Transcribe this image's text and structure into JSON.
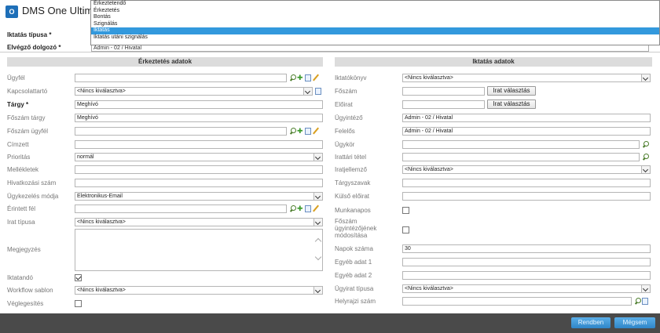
{
  "app": {
    "title": "DMS One Ultimate"
  },
  "dropdown": {
    "options": [
      "Érkeztetendő",
      "Érkeztetés",
      "Bontás",
      "Szignálás",
      "Iktatás",
      "Iktatás utáni szignálás"
    ],
    "selected": "Iktatás"
  },
  "top": {
    "iktatas_tipusa_label": "Iktatás típusa *",
    "elvegzo_label": "Elvégző dolgozó *",
    "elvegzo_value": "Admin - 02 / Hivatal"
  },
  "left": {
    "header": "Érkeztetés adatok",
    "ugyfel_label": "Ügyfél",
    "kapcsolattarto_label": "Kapcsolattartó",
    "kapcsolattarto_value": "<Nincs kiválasztva>",
    "targy_label": "Tárgy *",
    "targy_value": "Meghívó",
    "foszam_targy_label": "Főszám tárgy",
    "foszam_targy_value": "Meghívó",
    "foszam_ugyfel_label": "Főszám ügyfél",
    "cimzett_label": "Címzett",
    "prioritas_label": "Prioritás",
    "prioritas_value": "normál",
    "mellekletek_label": "Mellékletek",
    "hivatkozasi_szam_label": "Hivatkozási szám",
    "ugykezeles_modja_label": "Ügykezelés módja",
    "ugykezeles_modja_value": "Elektronikus-Email",
    "erintett_fel_label": "Érintett fél",
    "irat_tipusa_label": "Irat típusa",
    "irat_tipusa_value": "<Nincs kiválasztva>",
    "megjegyzes_label": "Megjegyzés",
    "iktatando_label": "Iktatandó",
    "iktatando_checked": true,
    "workflow_sablon_label": "Workflow sablon",
    "workflow_sablon_value": "<Nincs kiválasztva>",
    "veglegesites_label": "Véglegesítés",
    "veglegesites_checked": false
  },
  "right": {
    "header": "Iktatás adatok",
    "iktatokonyv_label": "Iktatókönyv",
    "iktatokonyv_value": "<Nincs kiválasztva>",
    "foszam_label": "Főszám",
    "foszam_button": "Irat választás",
    "eloirat_label": "Előirat",
    "eloirat_button": "Irat választás",
    "ugyintezo_label": "Ügyintéző",
    "ugyintezo_value": "Admin - 02 / Hivatal",
    "felelos_label": "Felelős",
    "felelos_value": "Admin - 02 / Hivatal",
    "ugykor_label": "Ügykör",
    "irattari_tetel_label": "Irattári tétel",
    "iratjellemzo_label": "Iratjellemző",
    "iratjellemzo_value": "<Nincs kiválasztva>",
    "targyszavak_label": "Tárgyszavak",
    "kulso_eloirat_label": "Külső előirat",
    "munkanapos_label": "Munkanapos",
    "munkanapos_checked": false,
    "foszam_ugyintezo_label_1": "Főszám",
    "foszam_ugyintezo_label_2": "ügyintézőjének",
    "foszam_ugyintezo_label_3": "módosítása",
    "foszam_ugyintezo_checked": false,
    "napok_szama_label": "Napok száma",
    "napok_szama_value": "30",
    "egyeb_adat_1_label": "Egyéb adat 1",
    "egyeb_adat_2_label": "Egyéb adat 2",
    "ugyirat_tipusa_label": "Ügyirat típusa",
    "ugyirat_tipusa_value": "<Nincs kiválasztva>",
    "helyrajzi_szam_label": "Helyrajzi szám"
  },
  "footer": {
    "ok_button": "Rendben",
    "cancel_button": "Mégsem"
  },
  "colors": {
    "accent": "#3399dd",
    "footer_bg": "#4a4a4a",
    "header_bg": "#dcdcdc"
  }
}
